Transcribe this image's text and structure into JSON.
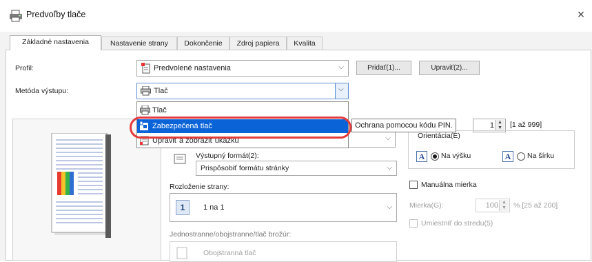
{
  "window": {
    "title": "Predvoľby tlače",
    "close_glyph": "×"
  },
  "tabs": [
    {
      "label": "Základné nastavenia",
      "active": true
    },
    {
      "label": "Nastavenie strany"
    },
    {
      "label": "Dokončenie"
    },
    {
      "label": "Zdroj papiera"
    },
    {
      "label": "Kvalita"
    }
  ],
  "profile": {
    "label": "Profil:",
    "value": "Predvolené nastavenia",
    "add_button": "Pridať(1)...",
    "edit_button": "Upraviť(2)..."
  },
  "output_method": {
    "label": "Metóda výstupu:",
    "value": "Tlač",
    "options": [
      {
        "label": "Tlač",
        "icon": "printer-icon"
      },
      {
        "label": "Zabezpečená tlač",
        "icon": "secure-print-icon",
        "selected": true
      },
      {
        "label": "Upraviť a zobraziť ukážku",
        "icon": "preview-edit-icon"
      }
    ]
  },
  "tooltip": "Ochrana pomocou kódu PIN.",
  "copies": {
    "value": "1",
    "range": "[1 až 999]"
  },
  "orientation": {
    "label": "Orientácia(E)",
    "portrait": "Na výšku",
    "landscape": "Na šírku",
    "selected": "portrait"
  },
  "output_format": {
    "label": "Výstupný formát(2):",
    "value": "Prispôsobiť formátu stránky"
  },
  "page_layout": {
    "label": "Rozloženie strany:",
    "value": "1 na 1",
    "badge": "1"
  },
  "manual_scale": {
    "label": "Manuálna mierka",
    "checked": false,
    "scale_label": "Mierka(G):",
    "scale_value": "100",
    "scale_range": "% [25 až 200]",
    "center_label": "Umiestniť do stredu(5)"
  },
  "duplex": {
    "label": "Jednostranne/obojstranne/tlač brožúr:",
    "value": "Obojstranná tlač"
  },
  "colors": {
    "accent": "#0a64d8",
    "highlight": "#e43a3a"
  }
}
